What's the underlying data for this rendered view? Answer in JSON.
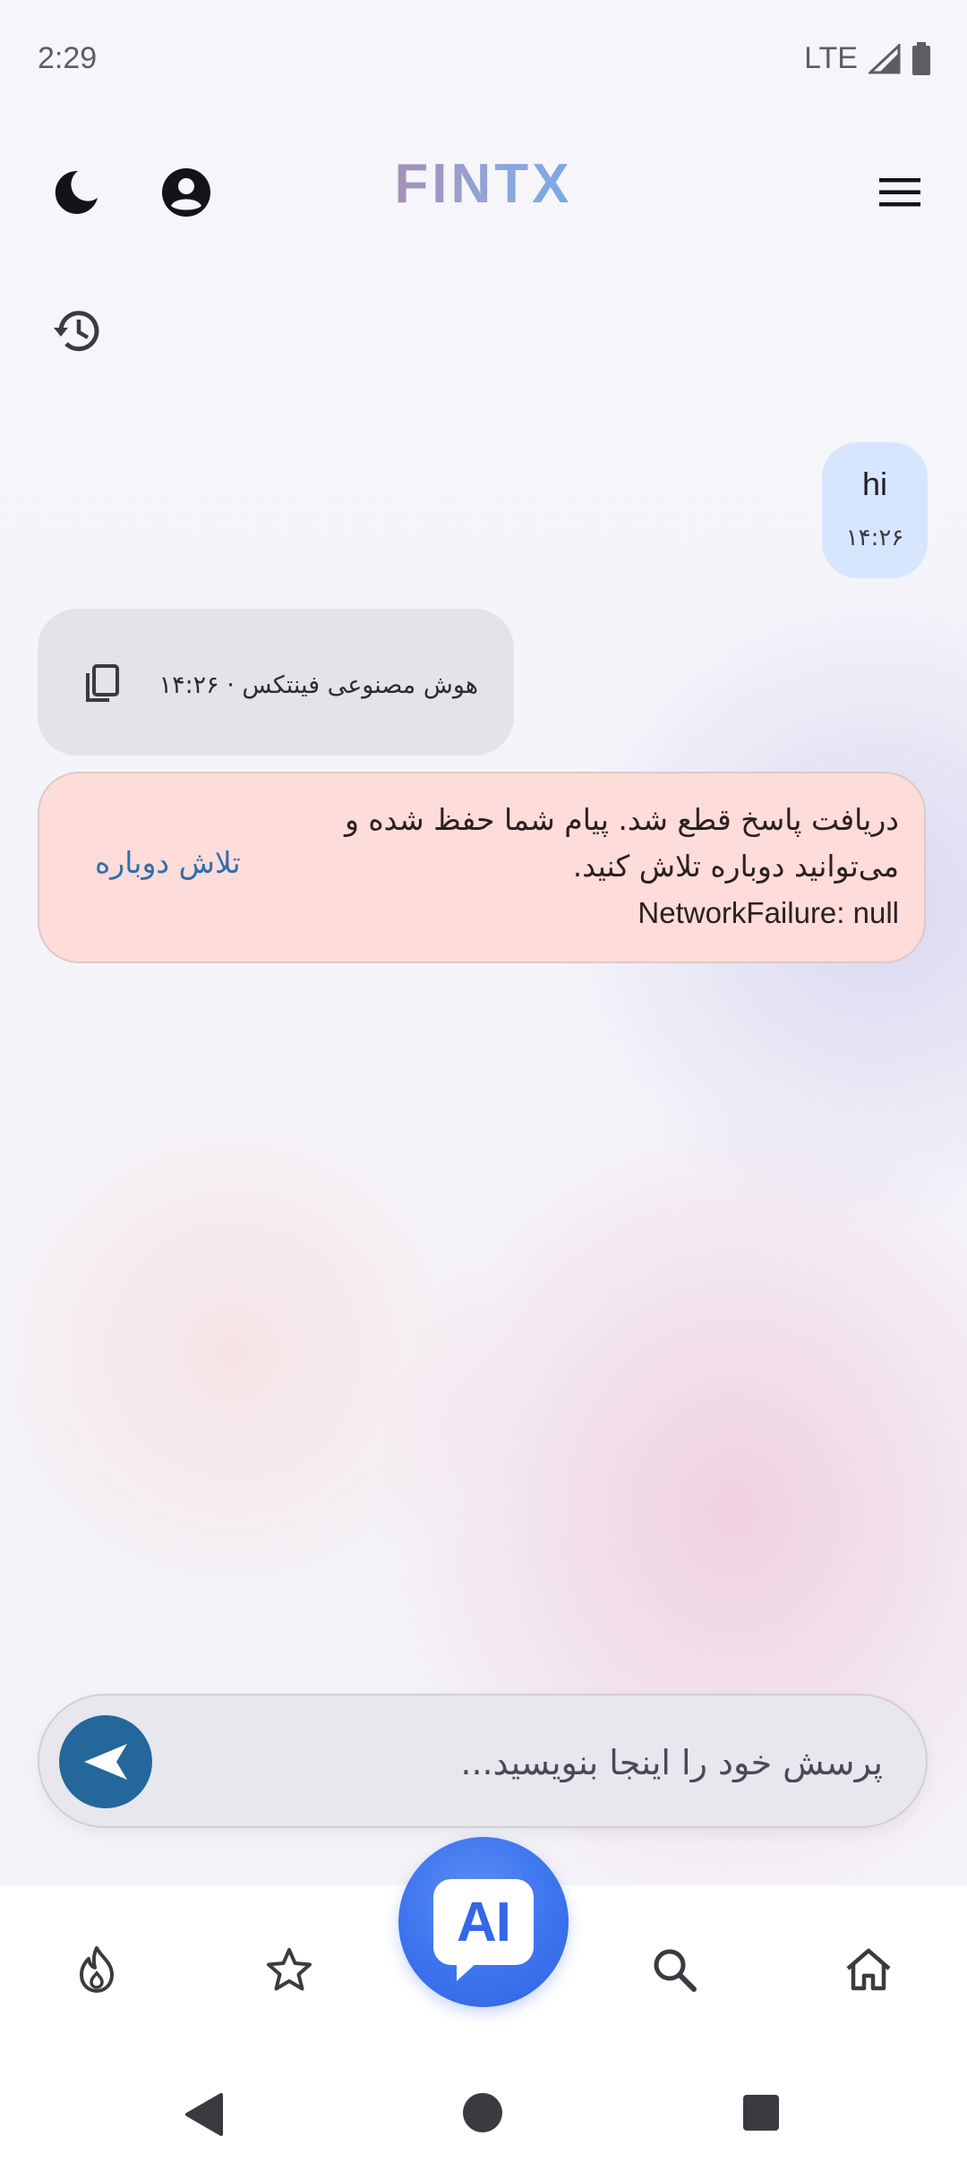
{
  "status_bar": {
    "time": "2:29",
    "network": "LTE"
  },
  "header": {
    "logo": "FINTX"
  },
  "chat": {
    "user_message": {
      "text": "hi",
      "time": "۱۴:۲۶"
    },
    "ai_meta": "هوش مصنوعی فینتکس · ۱۴:۲۶",
    "error": {
      "message": "دریافت پاسخ قطع شد. پیام شما حفظ شده و می‌توانید دوباره تلاش کنید.",
      "detail": "NetworkFailure: null",
      "retry_label": "تلاش دوباره"
    }
  },
  "composer": {
    "placeholder": "پرسش خود را اینجا بنویسید..."
  },
  "bottom_nav": {
    "ai_label": "AI"
  },
  "colors": {
    "accent": "#23679b",
    "error_bg": "#fddcda",
    "user_bubble": "#d7e6ff",
    "ai_fab": "#3d74ee"
  }
}
